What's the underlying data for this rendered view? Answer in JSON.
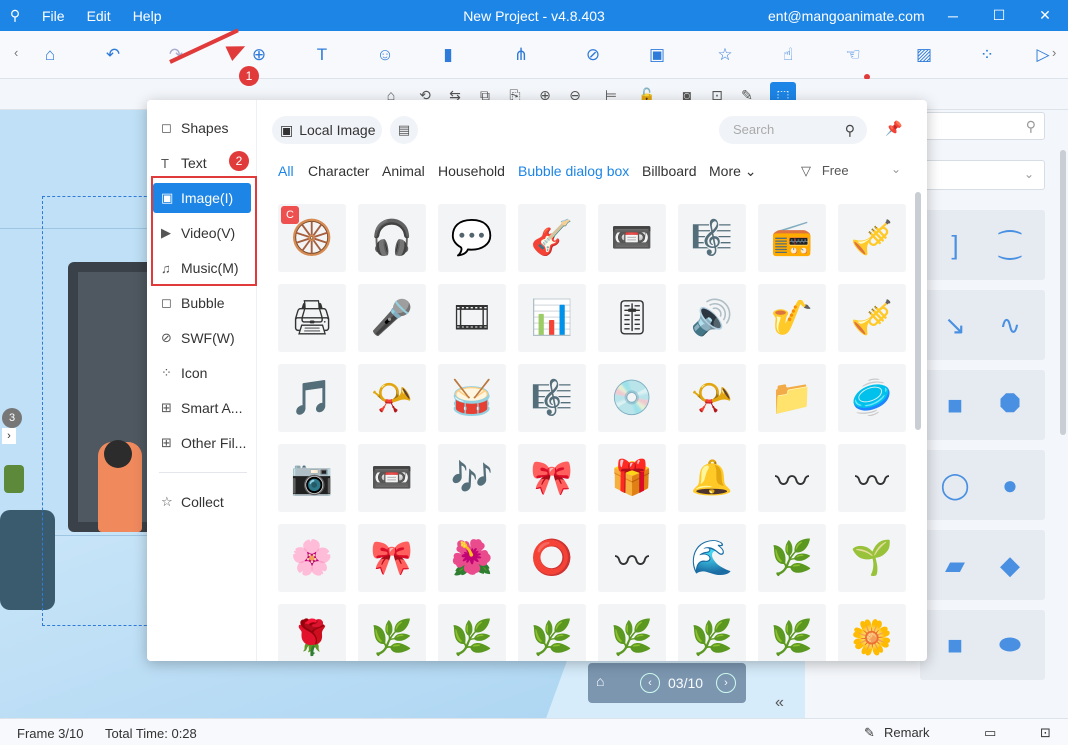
{
  "titlebar": {
    "app_icon": "mangoanimate-icon",
    "menu": [
      "File",
      "Edit",
      "Help"
    ],
    "title": "New Project - v4.8.403",
    "account": "ent@mangoanimate.com",
    "controls": [
      "─",
      "☐",
      "✕"
    ]
  },
  "toolbar": {
    "icons": [
      "home-icon",
      "undo-icon",
      "redo-icon",
      "add-element-icon",
      "text-icon",
      "role-icon",
      "chart-icon",
      "flowchart-icon",
      "link-icon",
      "image-icon",
      "effect-icon",
      "gesture-icon",
      "touch-icon",
      "pattern-icon",
      "grid-icon",
      "more-icon"
    ]
  },
  "canvas": {
    "frame_indicator": "3"
  },
  "pager": {
    "frame": "03/10"
  },
  "statusbar": {
    "frame": "Frame 3/10",
    "total_time": "Total Time: 0:28",
    "remark": "Remark"
  },
  "popup": {
    "sidebar": [
      {
        "label": "Shapes",
        "icon": "shapes-icon",
        "glyph": "◻"
      },
      {
        "label": "Text",
        "icon": "text-icon",
        "glyph": "T"
      },
      {
        "label": "Image(I)",
        "icon": "image-icon",
        "glyph": "🖼",
        "active": true
      },
      {
        "label": "Video(V)",
        "icon": "video-icon",
        "glyph": "▶"
      },
      {
        "label": "Music(M)",
        "icon": "music-icon",
        "glyph": "♫"
      },
      {
        "label": "Bubble",
        "icon": "bubble-icon",
        "glyph": "◻"
      },
      {
        "label": "SWF(W)",
        "icon": "swf-icon",
        "glyph": "⊘"
      },
      {
        "label": "Icon",
        "icon": "icon-grid-icon",
        "glyph": "⁘"
      },
      {
        "label": "Smart A...",
        "icon": "smart-art-icon",
        "glyph": "⊞"
      },
      {
        "label": "Other Fil...",
        "icon": "other-files-icon",
        "glyph": "⊞"
      },
      {
        "label": "Collect",
        "icon": "collect-icon",
        "glyph": "☆"
      }
    ],
    "local_image_label": "Local Image",
    "search_placeholder": "Search",
    "categories": [
      "All",
      "Character",
      "Animal",
      "Household",
      "Bubble dialog box",
      "Billboard",
      "More"
    ],
    "filter_label": "Free",
    "annotations": {
      "step1": "1",
      "step2": "2"
    },
    "copyright_mark": "C",
    "grid": [
      [
        "🛞",
        "🎧",
        "💬",
        "🎸",
        "📼",
        "🎼",
        "📻",
        "🎺"
      ],
      [
        "🖨",
        "🎤",
        "🎞",
        "📊",
        "🎚",
        "🔊",
        "🎷",
        "🎺"
      ],
      [
        "🎵",
        "📯",
        "🥁",
        "🎼",
        "💿",
        "📯",
        "📁",
        "🥏"
      ],
      [
        "📷",
        "📼",
        "🎶",
        "🎀",
        "🎁",
        "🔔",
        "〰",
        "〰"
      ],
      [
        "🌸",
        "🎀",
        "🌺",
        "⭕",
        "〰",
        "🌊",
        "🌿",
        "🌱"
      ],
      [
        "🌹",
        "🌿",
        "🌿",
        "🌿",
        "🌿",
        "🌿",
        "🌿",
        "🌼"
      ]
    ]
  },
  "colors": {
    "primary": "#1c85e6",
    "annotation_red": "#e03a3a"
  }
}
